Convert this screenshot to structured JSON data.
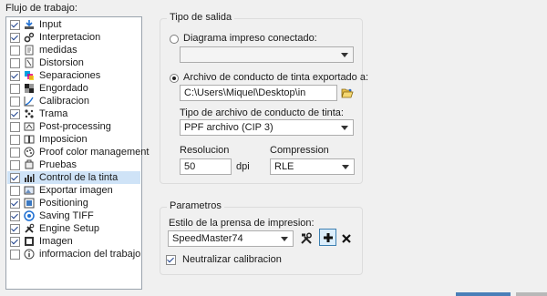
{
  "workflow": {
    "title": "Flujo de trabajo:",
    "items": [
      {
        "label": "Input",
        "checked": true,
        "icon": "input-icon"
      },
      {
        "label": "Interpretacion",
        "checked": true,
        "icon": "gears-icon"
      },
      {
        "label": "medidas",
        "checked": false,
        "icon": "page-icon"
      },
      {
        "label": "Distorsion",
        "checked": false,
        "icon": "distortion-icon"
      },
      {
        "label": "Separaciones",
        "checked": true,
        "icon": "separations-icon"
      },
      {
        "label": "Engordado",
        "checked": false,
        "icon": "dot-gain-icon"
      },
      {
        "label": "Calibracion",
        "checked": false,
        "icon": "curve-icon"
      },
      {
        "label": "Trama",
        "checked": true,
        "icon": "screen-icon"
      },
      {
        "label": "Post-processing",
        "checked": false,
        "icon": "post-processing-icon"
      },
      {
        "label": "Imposicion",
        "checked": false,
        "icon": "book-icon"
      },
      {
        "label": "Proof color management",
        "checked": false,
        "icon": "color-management-icon"
      },
      {
        "label": "Pruebas",
        "checked": false,
        "icon": "proof-icon"
      },
      {
        "label": "Control de la tinta",
        "checked": true,
        "icon": "ink-control-icon",
        "selected": true
      },
      {
        "label": "Exportar imagen",
        "checked": false,
        "icon": "export-image-icon"
      },
      {
        "label": "Positioning",
        "checked": true,
        "icon": "positioning-icon"
      },
      {
        "label": "Saving TIFF",
        "checked": true,
        "icon": "saving-tiff-icon"
      },
      {
        "label": "Engine Setup",
        "checked": true,
        "icon": "engine-setup-icon"
      },
      {
        "label": "Imagen",
        "checked": true,
        "icon": "image-icon"
      },
      {
        "label": "informacion del trabajo",
        "checked": false,
        "icon": "info-icon"
      }
    ]
  },
  "output_type": {
    "title": "Tipo de salida",
    "option_connected": "Diagrama impreso conectado:",
    "connected_value": "",
    "option_exported": "Archivo de conducto de tinta exportado a:",
    "selected_option": "exported",
    "path_value": "C:\\Users\\Miquel\\Desktop\\in",
    "file_type_label": "Tipo de archivo de conducto de tinta:",
    "file_type_value": "PPF archivo (CIP 3)",
    "resolution_label": "Resolucion",
    "resolution_value": "50",
    "resolution_unit": "dpi",
    "compression_label": "Compression",
    "compression_value": "RLE"
  },
  "parameters": {
    "title": "Parametros",
    "press_style_label": "Estilo de la prensa de impresion:",
    "press_style_value": "SpeedMaster74",
    "neutralize_label": "Neutralizar calibracion",
    "neutralize_checked": true
  },
  "colors": {
    "selection_bg": "#cfe3f7",
    "border": "#adadad",
    "accent": "#1b3f8b"
  }
}
